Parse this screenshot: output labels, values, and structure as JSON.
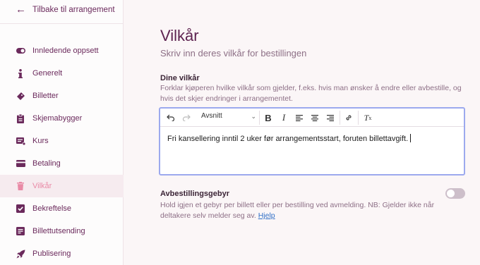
{
  "sidebar": {
    "back_label": "Tilbake til arrangement",
    "items": [
      {
        "label": "Innledende oppsett",
        "icon": "toggle-icon"
      },
      {
        "label": "Generelt",
        "icon": "info-icon"
      },
      {
        "label": "Billetter",
        "icon": "ticket-icon"
      },
      {
        "label": "Skjemabygger",
        "icon": "clipboard-icon"
      },
      {
        "label": "Kurs",
        "icon": "course-icon"
      },
      {
        "label": "Betaling",
        "icon": "credit-card-icon"
      },
      {
        "label": "Vilkår",
        "icon": "trash-icon",
        "active": true
      },
      {
        "label": "Bekreftelse",
        "icon": "checkbox-icon"
      },
      {
        "label": "Billettutsending",
        "icon": "send-icon"
      },
      {
        "label": "Publisering",
        "icon": "rocket-icon"
      }
    ]
  },
  "main": {
    "title": "Vilkår",
    "subtitle": "Skriv inn deres vilkår for bestillingen",
    "terms_title": "Dine vilkår",
    "terms_desc": "Forklar kjøperen hvilke vilkår som gjelder, f.eks. hvis man ønsker å endre eller avbestille, og hvis det skjer endringer i arrangementet.",
    "editor": {
      "format_value": "Avsnitt",
      "content": "Fri kansellering inntil 2 uker før arrangementsstart, foruten billettavgift."
    },
    "cancel_title": "Avbestillingsgebyr",
    "cancel_desc": "Hold igjen et gebyr per billett eller per bestilling ved avmelding. NB: Gjelder ikke når deltakere selv melder seg av.",
    "help_link": "Hjelp",
    "cancel_fee_enabled": false
  },
  "colors": {
    "accent": "#6b2a5c",
    "active_text": "#e98aa6",
    "editor_border": "#9ca9ee",
    "link": "#2f6fc7"
  }
}
